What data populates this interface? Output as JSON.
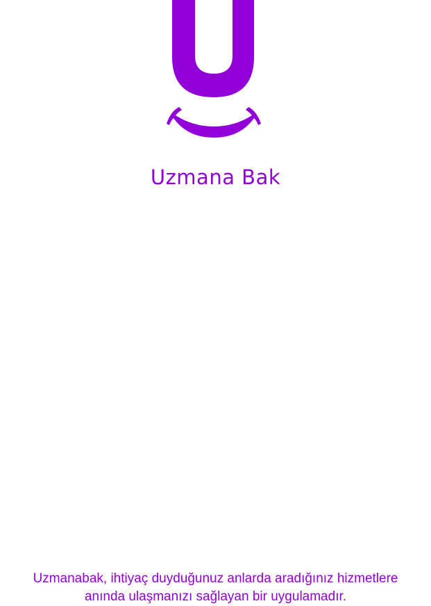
{
  "brand": {
    "name": "Uzmana Bak",
    "logo_icon": "smiling-u-logo-icon",
    "color": "#9100d6"
  },
  "tagline": {
    "line1": "Uzmanabak, ihtiyaç duyduğunuz anlarda aradığınız hizmetlere",
    "line2": "anında ulaşmanızı sağlayan bir uygulamadır."
  }
}
